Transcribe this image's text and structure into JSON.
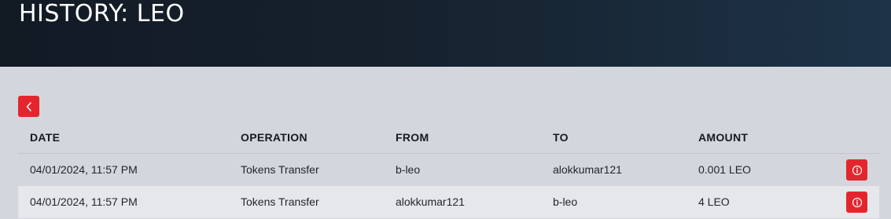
{
  "header": {
    "title": "HISTORY: LEO"
  },
  "table": {
    "columns": [
      "DATE",
      "OPERATION",
      "FROM",
      "TO",
      "AMOUNT"
    ],
    "rows": [
      {
        "date": "04/01/2024, 11:57 PM",
        "operation": "Tokens Transfer",
        "from": "b-leo",
        "to": "alokkumar121",
        "amount": "0.001 LEO"
      },
      {
        "date": "04/01/2024, 11:57 PM",
        "operation": "Tokens Transfer",
        "from": "alokkumar121",
        "to": "b-leo",
        "amount": "4 LEO"
      }
    ]
  },
  "icons": {
    "back": "chevron-left-icon",
    "info": "info-icon"
  },
  "colors": {
    "accent": "#e3262d",
    "header_dark": "#121a24",
    "header_light": "#1d3347",
    "background": "#d3d6dd"
  }
}
